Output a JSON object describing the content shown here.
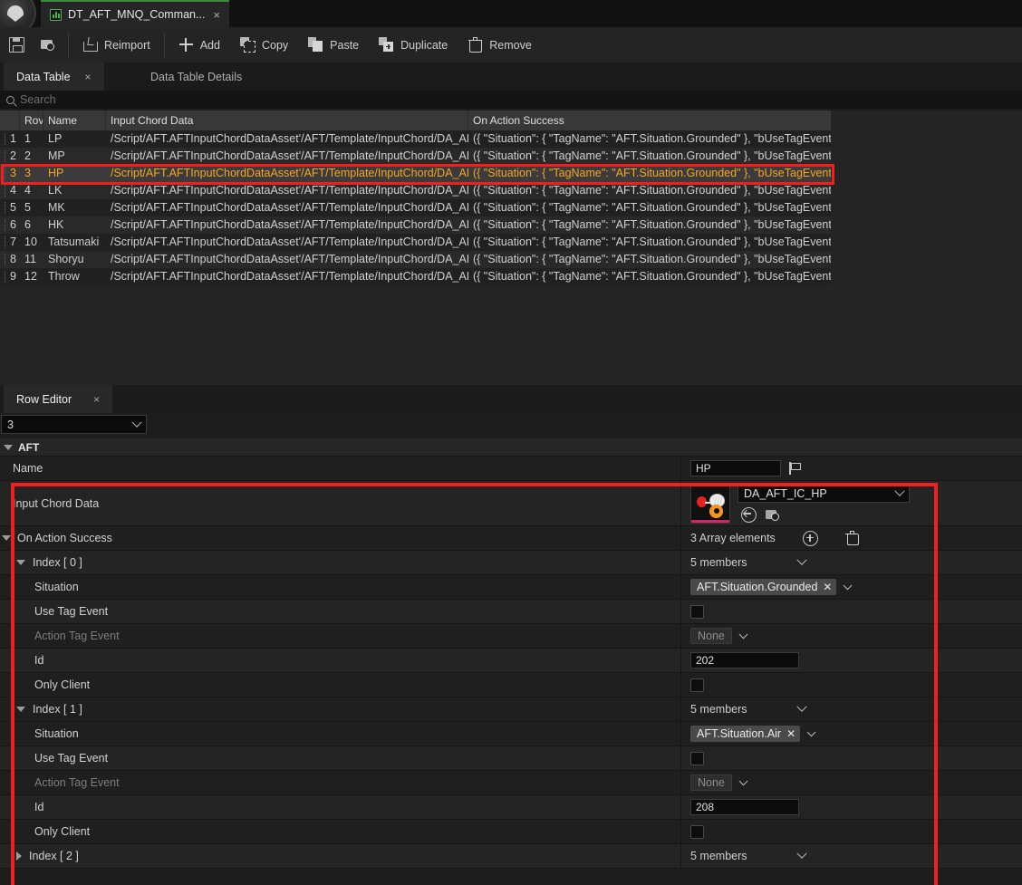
{
  "window": {
    "document_tab_title": "DT_AFT_MNQ_Comman...",
    "document_tab_icon": "data-table-icon",
    "close_glyph": "×"
  },
  "toolbar": {
    "buttons": [
      {
        "label": "",
        "icon": "save-icon"
      },
      {
        "label": "",
        "icon": "browse-content-icon"
      },
      {
        "label": "Reimport",
        "icon": "reimport-icon"
      },
      {
        "label": "Add",
        "icon": "plus-icon"
      },
      {
        "label": "Copy",
        "icon": "copy-icon"
      },
      {
        "label": "Paste",
        "icon": "paste-icon"
      },
      {
        "label": "Duplicate",
        "icon": "duplicate-icon"
      },
      {
        "label": "Remove",
        "icon": "trash-icon"
      }
    ]
  },
  "panel_tabs": {
    "active": "Data Table",
    "inactive": "Data Table Details",
    "close_glyph": "×"
  },
  "search": {
    "placeholder": "Search",
    "value": "",
    "icon": "search-icon"
  },
  "data_table": {
    "columns": [
      "",
      "Rov",
      "Name",
      "Input Chord Data",
      "On Action Success"
    ],
    "selected_row_index": 2,
    "rows": [
      {
        "n": "1",
        "row": "1",
        "name": "LP",
        "chord": "/Script/AFT.AFTInputChordDataAsset'/AFT/Template/InputChord/DA_AF",
        "success": "({ \"Situation\": { \"TagName\": \"AFT.Situation.Grounded\" }, \"bUseTagEvent\": f"
      },
      {
        "n": "2",
        "row": "2",
        "name": "MP",
        "chord": "/Script/AFT.AFTInputChordDataAsset'/AFT/Template/InputChord/DA_AF",
        "success": "({ \"Situation\": { \"TagName\": \"AFT.Situation.Grounded\" }, \"bUseTagEvent\": f"
      },
      {
        "n": "3",
        "row": "3",
        "name": "HP",
        "chord": "/Script/AFT.AFTInputChordDataAsset'/AFT/Template/InputChord/DA_AF",
        "success": "({ \"Situation\": { \"TagName\": \"AFT.Situation.Grounded\" }, \"bUseTagEvent\": f"
      },
      {
        "n": "4",
        "row": "4",
        "name": "LK",
        "chord": "/Script/AFT.AFTInputChordDataAsset'/AFT/Template/InputChord/DA_AF",
        "success": "({ \"Situation\": { \"TagName\": \"AFT.Situation.Grounded\" }, \"bUseTagEvent\": f"
      },
      {
        "n": "5",
        "row": "5",
        "name": "MK",
        "chord": "/Script/AFT.AFTInputChordDataAsset'/AFT/Template/InputChord/DA_AF",
        "success": "({ \"Situation\": { \"TagName\": \"AFT.Situation.Grounded\" }, \"bUseTagEvent\": f"
      },
      {
        "n": "6",
        "row": "6",
        "name": "HK",
        "chord": "/Script/AFT.AFTInputChordDataAsset'/AFT/Template/InputChord/DA_AF",
        "success": "({ \"Situation\": { \"TagName\": \"AFT.Situation.Grounded\" }, \"bUseTagEvent\": f"
      },
      {
        "n": "7",
        "row": "10",
        "name": "Tatsumaki",
        "chord": "/Script/AFT.AFTInputChordDataAsset'/AFT/Template/InputChord/DA_AF",
        "success": "({ \"Situation\": { \"TagName\": \"AFT.Situation.Grounded\" }, \"bUseTagEvent\": f"
      },
      {
        "n": "8",
        "row": "11",
        "name": "Shoryu",
        "chord": "/Script/AFT.AFTInputChordDataAsset'/AFT/Template/InputChord/DA_AF",
        "success": "({ \"Situation\": { \"TagName\": \"AFT.Situation.Grounded\" }, \"bUseTagEvent\": f"
      },
      {
        "n": "9",
        "row": "12",
        "name": "Throw",
        "chord": "/Script/AFT.AFTInputChordDataAsset'/AFT/Template/InputChord/DA_AF",
        "success": "({ \"Situation\": { \"TagName\": \"AFT.Situation.Grounded\" }, \"bUseTagEvent\": f"
      }
    ]
  },
  "row_editor": {
    "tab_label": "Row Editor",
    "close_glyph": "×",
    "selected_row": "3",
    "category": "AFT",
    "name_label": "Name",
    "name_value": "HP",
    "input_chord_label": "Input Chord Data",
    "input_chord_asset": "DA_AFT_IC_HP",
    "on_action_success_label": "On Action Success",
    "array_elements_text": "3 Array elements",
    "members_text": "5 members",
    "indices": [
      {
        "label": "Index [ 0 ]",
        "members": "5 members",
        "expanded": true,
        "fields": {
          "situation_label": "Situation",
          "situation_value": "AFT.Situation.Grounded",
          "use_tag_event_label": "Use Tag Event",
          "use_tag_event_checked": false,
          "action_tag_event_label": "Action Tag Event",
          "action_tag_event_value": "None",
          "id_label": "Id",
          "id_value": "202",
          "only_client_label": "Only Client",
          "only_client_checked": false
        }
      },
      {
        "label": "Index [ 1 ]",
        "members": "5 members",
        "expanded": true,
        "fields": {
          "situation_label": "Situation",
          "situation_value": "AFT.Situation.Air",
          "use_tag_event_label": "Use Tag Event",
          "use_tag_event_checked": false,
          "action_tag_event_label": "Action Tag Event",
          "action_tag_event_value": "None",
          "id_label": "Id",
          "id_value": "208",
          "only_client_label": "Only Client",
          "only_client_checked": false
        }
      },
      {
        "label": "Index [ 2 ]",
        "members": "5 members",
        "expanded": false
      }
    ]
  },
  "colors": {
    "highlight_red": "#f21f1f",
    "selected_text_orange": "#f5a623",
    "accent_green": "#4caf50"
  }
}
